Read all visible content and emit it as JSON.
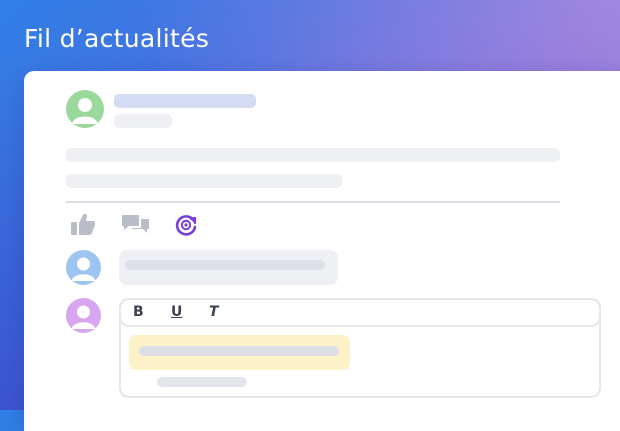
{
  "header": {
    "title": "Fil d’actualités"
  },
  "editor": {
    "toolbar": {
      "bold_label": "B",
      "underline_label": "U",
      "italic_label": "T"
    }
  },
  "icons": {
    "like": "thumbs-up-icon",
    "comment": "chat-bubbles-icon",
    "share": "share-spiral-icon",
    "avatar": "user-avatar-icon"
  },
  "colors": {
    "avatar_post": "#9bd89b",
    "avatar_comment": "#9cc5f2",
    "avatar_editor": "#d7a6ee",
    "accent": "#7a3fd6",
    "highlight": "#fdf1c7"
  }
}
